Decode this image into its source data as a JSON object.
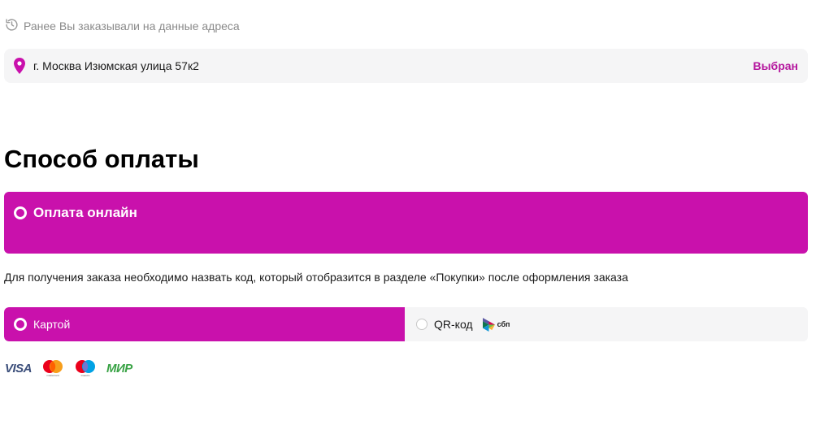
{
  "address_history": {
    "label": "Ранее Вы заказывали на данные адреса",
    "icon": "history-icon"
  },
  "address": {
    "text": "г. Москва Изюмская улица 57к2",
    "status": "Выбран",
    "icon": "map-pin-icon"
  },
  "payment": {
    "title": "Способ оплаты",
    "online_label": "Оплата онлайн",
    "note": "Для получения заказа необходимо назвать код, который отобразится в разделе «Покупки» после оформления заказа",
    "tabs": [
      {
        "label": "Картой",
        "selected": true
      },
      {
        "label": "QR-код",
        "selected": false
      }
    ],
    "sbp_label": "сбп",
    "card_brands": {
      "visa": "VISA",
      "mastercard": "mastercard",
      "maestro": "maestro",
      "mir": "МИР"
    }
  },
  "colors": {
    "accent": "#c911ac",
    "status_text": "#b5179e",
    "card_bg": "#f5f5f6",
    "muted_text": "#8a8a8a"
  }
}
